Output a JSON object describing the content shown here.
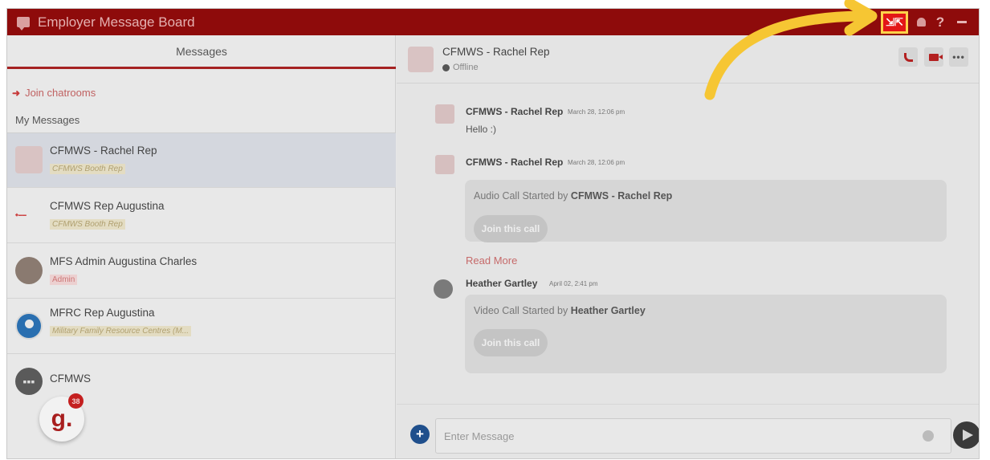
{
  "titlebar": {
    "title": "Employer Message Board",
    "help_label": "?"
  },
  "left_panel": {
    "tab_label": "Messages",
    "join_label": "Join chatrooms",
    "section_label": "My Messages",
    "contacts": [
      {
        "name": "CFMWS - Rachel Rep",
        "subtitle": "CFMWS Booth Rep"
      },
      {
        "name": "CFMWS Rep Augustina",
        "subtitle": "CFMWS Booth Rep"
      },
      {
        "name": "MFS Admin Augustina Charles",
        "subtitle": "Admin"
      },
      {
        "name": "MFRC Rep Augustina",
        "subtitle": "Military Family Resource Centres (M..."
      },
      {
        "name": "CFMWS",
        "subtitle": ""
      }
    ],
    "badge": {
      "letter": "g.",
      "count": "38"
    }
  },
  "chat": {
    "header": {
      "name": "CFMWS - Rachel Rep",
      "status": "Offline"
    },
    "messages": [
      {
        "sender": "CFMWS - Rachel Rep",
        "time": "March 28, 12:06 pm",
        "text": "Hello :)"
      },
      {
        "sender": "CFMWS - Rachel Rep",
        "time": "March 28, 12:06 pm",
        "call_prefix": "Audio Call Started by",
        "call_by": "CFMWS - Rachel Rep",
        "join_label": "Join this call"
      },
      {
        "sender": "Heather Gartley",
        "time": "April 02, 2:41 pm",
        "call_prefix": "Video Call Started by",
        "call_by": "Heather Gartley",
        "join_label": "Join this call"
      }
    ],
    "read_more": "Read More",
    "composer": {
      "placeholder": "Enter Message"
    }
  },
  "colors": {
    "titlebar": "#8e0b0b",
    "accent": "#a52222",
    "highlight": "#ffd34a"
  }
}
